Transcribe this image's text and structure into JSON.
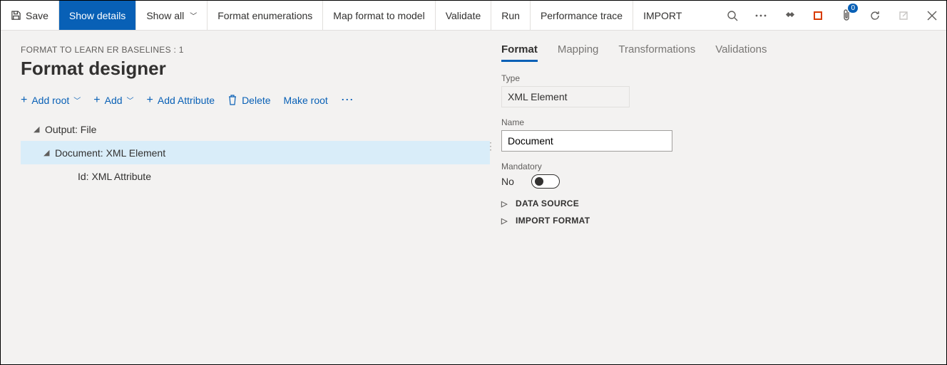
{
  "toolbar": {
    "save": "Save",
    "show_details": "Show details",
    "show_all": "Show all",
    "format_enum": "Format enumerations",
    "map_format": "Map format to model",
    "validate": "Validate",
    "run": "Run",
    "perf_trace": "Performance trace",
    "import": "IMPORT",
    "badge_count": "0"
  },
  "header": {
    "breadcrumb": "FORMAT TO LEARN ER BASELINES : 1",
    "title": "Format designer"
  },
  "actions": {
    "add_root": "Add root",
    "add": "Add",
    "add_attribute": "Add Attribute",
    "delete": "Delete",
    "make_root": "Make root"
  },
  "tree": {
    "n1": "Output: File",
    "n2": "Document: XML Element",
    "n3": "Id: XML Attribute"
  },
  "tabs": {
    "format": "Format",
    "mapping": "Mapping",
    "transformations": "Transformations",
    "validations": "Validations"
  },
  "panel": {
    "type_label": "Type",
    "type_value": "XML Element",
    "name_label": "Name",
    "name_value": "Document",
    "mandatory_label": "Mandatory",
    "mandatory_value": "No",
    "exp_data_source": "DATA SOURCE",
    "exp_import_format": "IMPORT FORMAT"
  }
}
